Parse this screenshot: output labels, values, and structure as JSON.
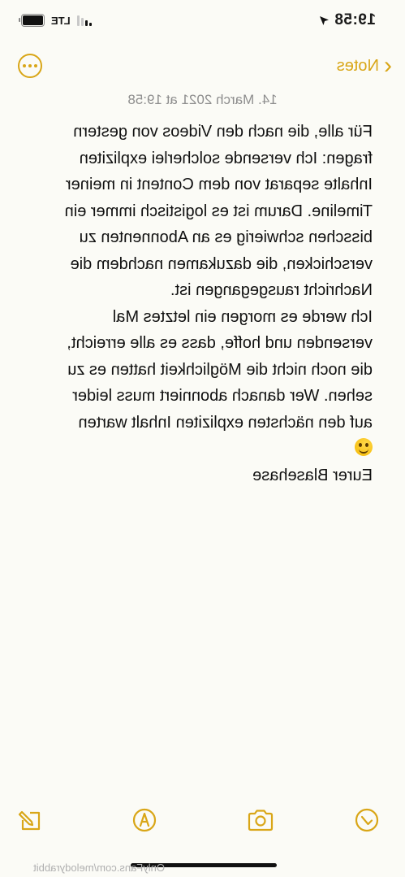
{
  "status_bar": {
    "time": "19:58",
    "network": "LTE"
  },
  "nav": {
    "back_label": "Notes",
    "icons": {
      "back": "chevron-left-icon",
      "more": "ellipsis-circle-icon"
    }
  },
  "note": {
    "date": "14. March 2021 at 19:58",
    "lines": [
      "Für alle, die nach den Videos von gestern",
      "fragen: Ich versende solcherlei expliziten",
      "Inhalte separat von dem Content in meiner",
      "Timeline. Darum ist es logistisch immer ein",
      "bisschen schwierig es an Abonnenten zu",
      "verschicken, die dazukamen nachdem die",
      "Nachricht rausgegangen ist.",
      "Ich werde es morgen ein letztes Mal",
      "versenden und hoffe, dass es alle erreicht,",
      "die noch nicht die Möglichkeit hatten es zu",
      "sehen. Wer danach abonniert muss leider",
      "auf den nächsten expliziten Inhalt warten"
    ],
    "signature": "Eurer Blasehase",
    "emoji": "smiling-face-emoji"
  },
  "toolbar": {
    "icons": [
      "checklist-icon",
      "camera-icon",
      "markup-pen-icon",
      "compose-icon"
    ]
  },
  "watermark": "OnlyFans.com/melodyrabbit",
  "colors": {
    "accent": "#d9a617",
    "background": "#fbfbf6",
    "date_text": "#8e8e8e"
  }
}
